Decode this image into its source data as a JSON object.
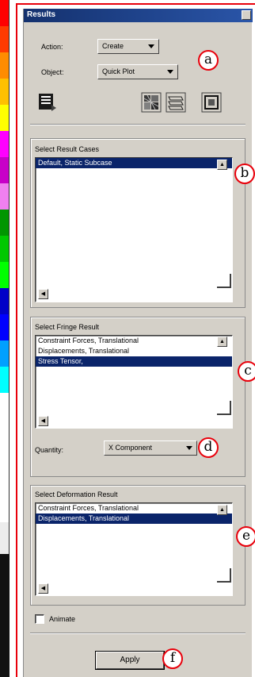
{
  "panel": {
    "title": "Results"
  },
  "form": {
    "action_label": "Action:",
    "action_value": "Create",
    "object_label": "Object:",
    "object_value": "Quick Plot"
  },
  "result_cases": {
    "title": "Select Result Cases",
    "items": [
      {
        "label": "Default, Static Subcase",
        "selected": true
      }
    ]
  },
  "fringe": {
    "title": "Select Fringe Result",
    "items": [
      {
        "label": "Constraint Forces, Translational",
        "selected": false
      },
      {
        "label": "Displacements, Translational",
        "selected": false
      },
      {
        "label": "Stress Tensor,",
        "selected": true
      }
    ],
    "quantity_label": "Quantity:",
    "quantity_value": "X Component"
  },
  "deformation": {
    "title": "Select Deformation Result",
    "items": [
      {
        "label": "Constraint Forces, Translational",
        "selected": false
      },
      {
        "label": "Displacements, Translational",
        "selected": true
      }
    ]
  },
  "animate": {
    "label": "Animate",
    "checked": false
  },
  "apply_label": "Apply",
  "callouts": {
    "a": "a",
    "b": "b",
    "c": "c",
    "d": "d",
    "e": "e",
    "f": "f"
  },
  "colors": {
    "selection": "#0a246a",
    "callout_border": "#e8000b",
    "panel_bg": "#d4d0c8",
    "fringe_strip": [
      "#ff0000",
      "#ff3b00",
      "#ff8c00",
      "#ffc000",
      "#ffff00",
      "#ff00ff",
      "#c800c8",
      "#f080f0",
      "#009600",
      "#00c800",
      "#00ff00",
      "#0000c8",
      "#0000ff",
      "#00a0ff",
      "#00ffff",
      "#ffffff"
    ]
  }
}
